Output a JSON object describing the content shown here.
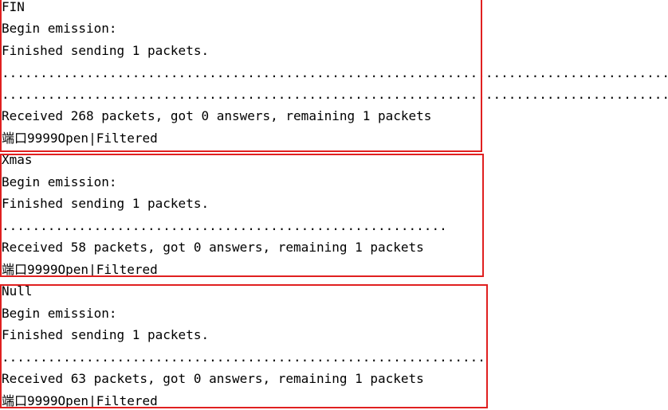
{
  "colors": {
    "text": "#000000",
    "box_border": "#e02020",
    "background": "#ffffff"
  },
  "sections": [
    {
      "lines": [
        "FIN",
        "Begin emission:",
        "Finished sending 1 packets.",
        "........................................................................................................................................",
        "........................................................................................................................................",
        "Received 268 packets, got 0 answers, remaining 1 packets",
        "端口9999Open|Filtered"
      ]
    },
    {
      "lines": [
        "Xmas",
        "Begin emission:",
        "Finished sending 1 packets.",
        "..........................................................",
        "Received 58 packets, got 0 answers, remaining 1 packets",
        "端口9999Open|Filtered"
      ]
    },
    {
      "lines": [
        "Null",
        "Begin emission:",
        "Finished sending 1 packets.",
        "...............................................................",
        "Received 63 packets, got 0 answers, remaining 1 packets",
        "端口9999Open|Filtered"
      ]
    }
  ]
}
